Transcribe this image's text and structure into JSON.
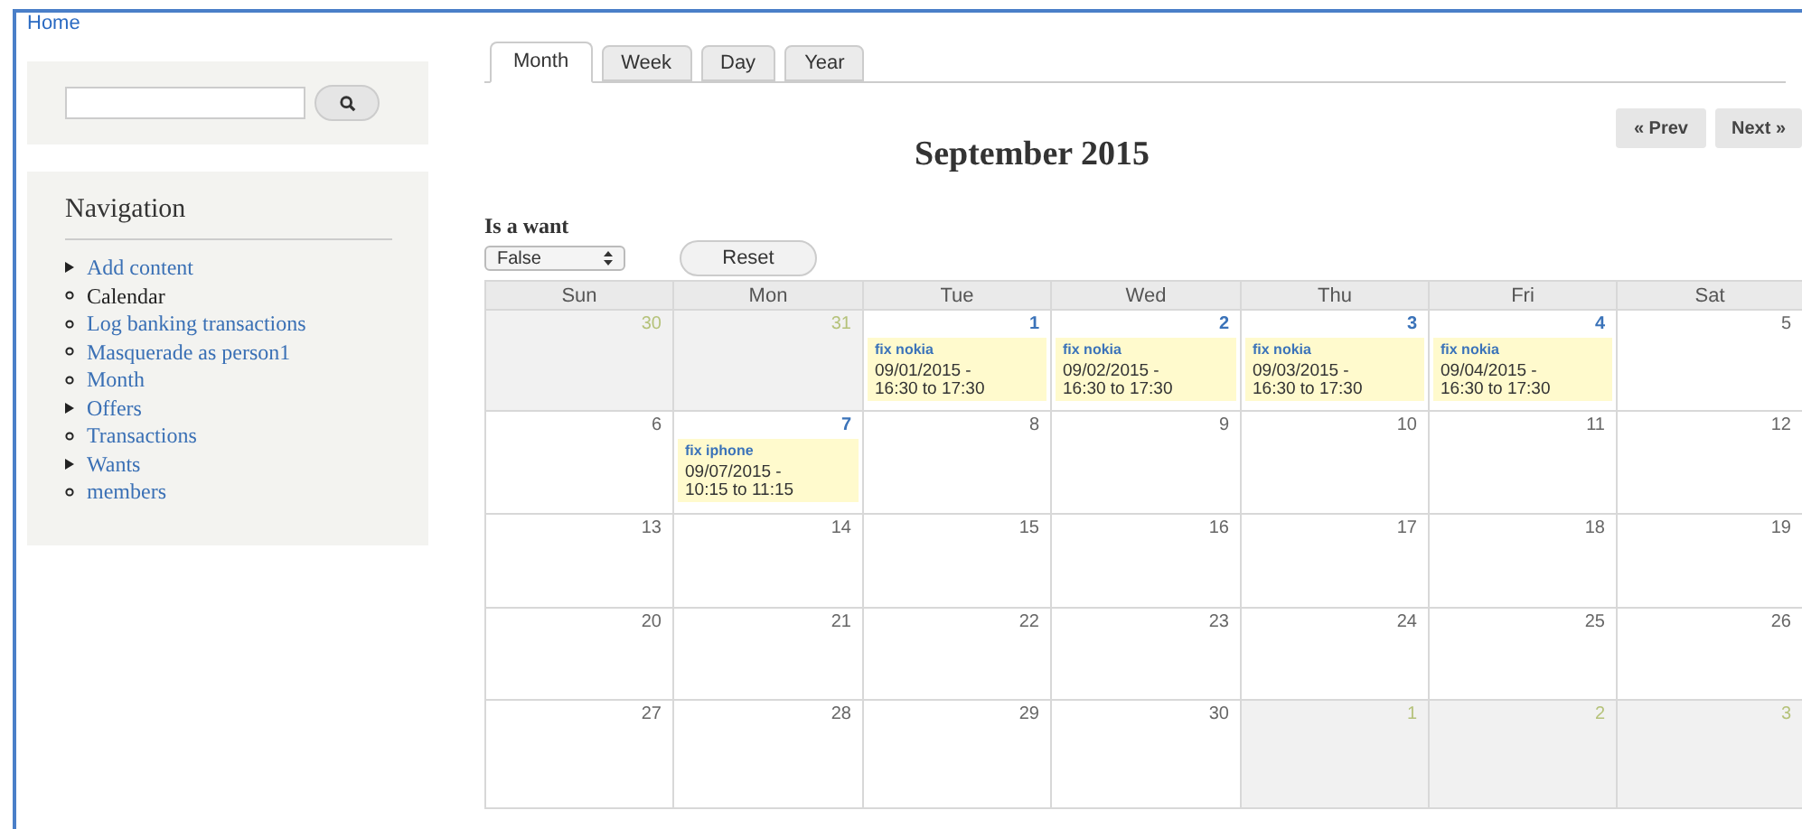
{
  "breadcrumb": "Home",
  "navigation": {
    "title": "Navigation",
    "items": [
      {
        "label": "Add content",
        "kind": "arrow",
        "selected": false
      },
      {
        "label": "Calendar",
        "kind": "dot",
        "selected": true
      },
      {
        "label": "Log banking transactions",
        "kind": "dot",
        "selected": false
      },
      {
        "label": "Masquerade as person1",
        "kind": "dot",
        "selected": false
      },
      {
        "label": "Month",
        "kind": "dot",
        "selected": false
      },
      {
        "label": "Offers",
        "kind": "arrow",
        "selected": false
      },
      {
        "label": "Transactions",
        "kind": "dot",
        "selected": false
      },
      {
        "label": "Wants",
        "kind": "arrow",
        "selected": false
      },
      {
        "label": "members",
        "kind": "dot",
        "selected": false
      }
    ]
  },
  "tabs": [
    {
      "label": "Month",
      "selected": true
    },
    {
      "label": "Week",
      "selected": false
    },
    {
      "label": "Day",
      "selected": false
    },
    {
      "label": "Year",
      "selected": false
    }
  ],
  "pager": {
    "prev": "« Prev",
    "next": "Next »"
  },
  "calendar_title": "September 2015",
  "filter": {
    "label": "Is a want",
    "value": "False",
    "reset": "Reset"
  },
  "weekdays": [
    "Sun",
    "Mon",
    "Tue",
    "Wed",
    "Thu",
    "Fri",
    "Sat"
  ],
  "weeks": [
    [
      {
        "day": "30",
        "kind": "other"
      },
      {
        "day": "31",
        "kind": "other"
      },
      {
        "day": "1",
        "kind": "current",
        "events": [
          {
            "title": "fix nokia",
            "time": "09/01/2015 - 16:30 to 17:30"
          }
        ]
      },
      {
        "day": "2",
        "kind": "current",
        "events": [
          {
            "title": "fix nokia",
            "time": "09/02/2015 - 16:30 to 17:30"
          }
        ]
      },
      {
        "day": "3",
        "kind": "current",
        "events": [
          {
            "title": "fix nokia",
            "time": "09/03/2015 - 16:30 to 17:30"
          }
        ]
      },
      {
        "day": "4",
        "kind": "current",
        "events": [
          {
            "title": "fix nokia",
            "time": "09/04/2015 - 16:30 to 17:30"
          }
        ]
      },
      {
        "day": "5",
        "kind": "current"
      }
    ],
    [
      {
        "day": "6",
        "kind": "current"
      },
      {
        "day": "7",
        "kind": "current",
        "events": [
          {
            "title": "fix iphone",
            "time": "09/07/2015 - 10:15 to 11:15"
          }
        ]
      },
      {
        "day": "8",
        "kind": "current"
      },
      {
        "day": "9",
        "kind": "current"
      },
      {
        "day": "10",
        "kind": "current"
      },
      {
        "day": "11",
        "kind": "current"
      },
      {
        "day": "12",
        "kind": "current"
      }
    ],
    [
      {
        "day": "13",
        "kind": "current"
      },
      {
        "day": "14",
        "kind": "current"
      },
      {
        "day": "15",
        "kind": "current"
      },
      {
        "day": "16",
        "kind": "current"
      },
      {
        "day": "17",
        "kind": "current"
      },
      {
        "day": "18",
        "kind": "current"
      },
      {
        "day": "19",
        "kind": "current"
      }
    ],
    [
      {
        "day": "20",
        "kind": "current"
      },
      {
        "day": "21",
        "kind": "current"
      },
      {
        "day": "22",
        "kind": "current"
      },
      {
        "day": "23",
        "kind": "current"
      },
      {
        "day": "24",
        "kind": "current"
      },
      {
        "day": "25",
        "kind": "current"
      },
      {
        "day": "26",
        "kind": "current"
      }
    ],
    [
      {
        "day": "27",
        "kind": "current"
      },
      {
        "day": "28",
        "kind": "current"
      },
      {
        "day": "29",
        "kind": "current"
      },
      {
        "day": "30",
        "kind": "current"
      },
      {
        "day": "1",
        "kind": "other"
      },
      {
        "day": "2",
        "kind": "other"
      },
      {
        "day": "3",
        "kind": "other"
      }
    ]
  ]
}
